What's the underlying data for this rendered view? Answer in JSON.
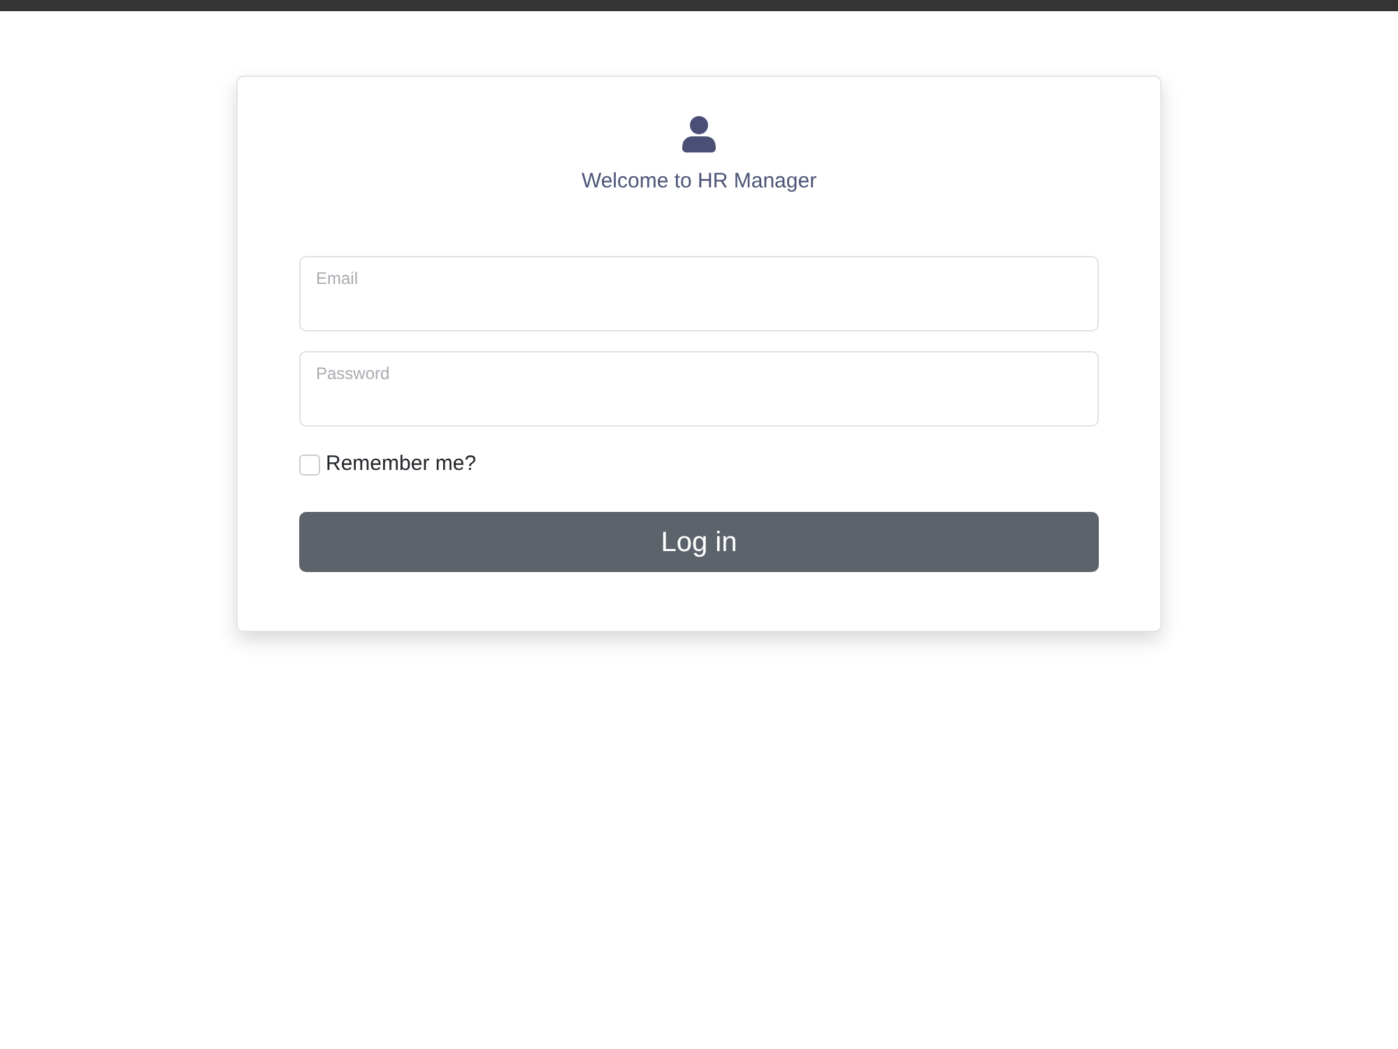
{
  "header": {
    "title": "Welcome to HR Manager"
  },
  "fields": [
    {
      "placeholder": "Email"
    },
    {
      "placeholder": "Password"
    }
  ],
  "remember": {
    "label": "Remember me?",
    "checked": false
  },
  "submit": {
    "label": "Log in"
  }
}
